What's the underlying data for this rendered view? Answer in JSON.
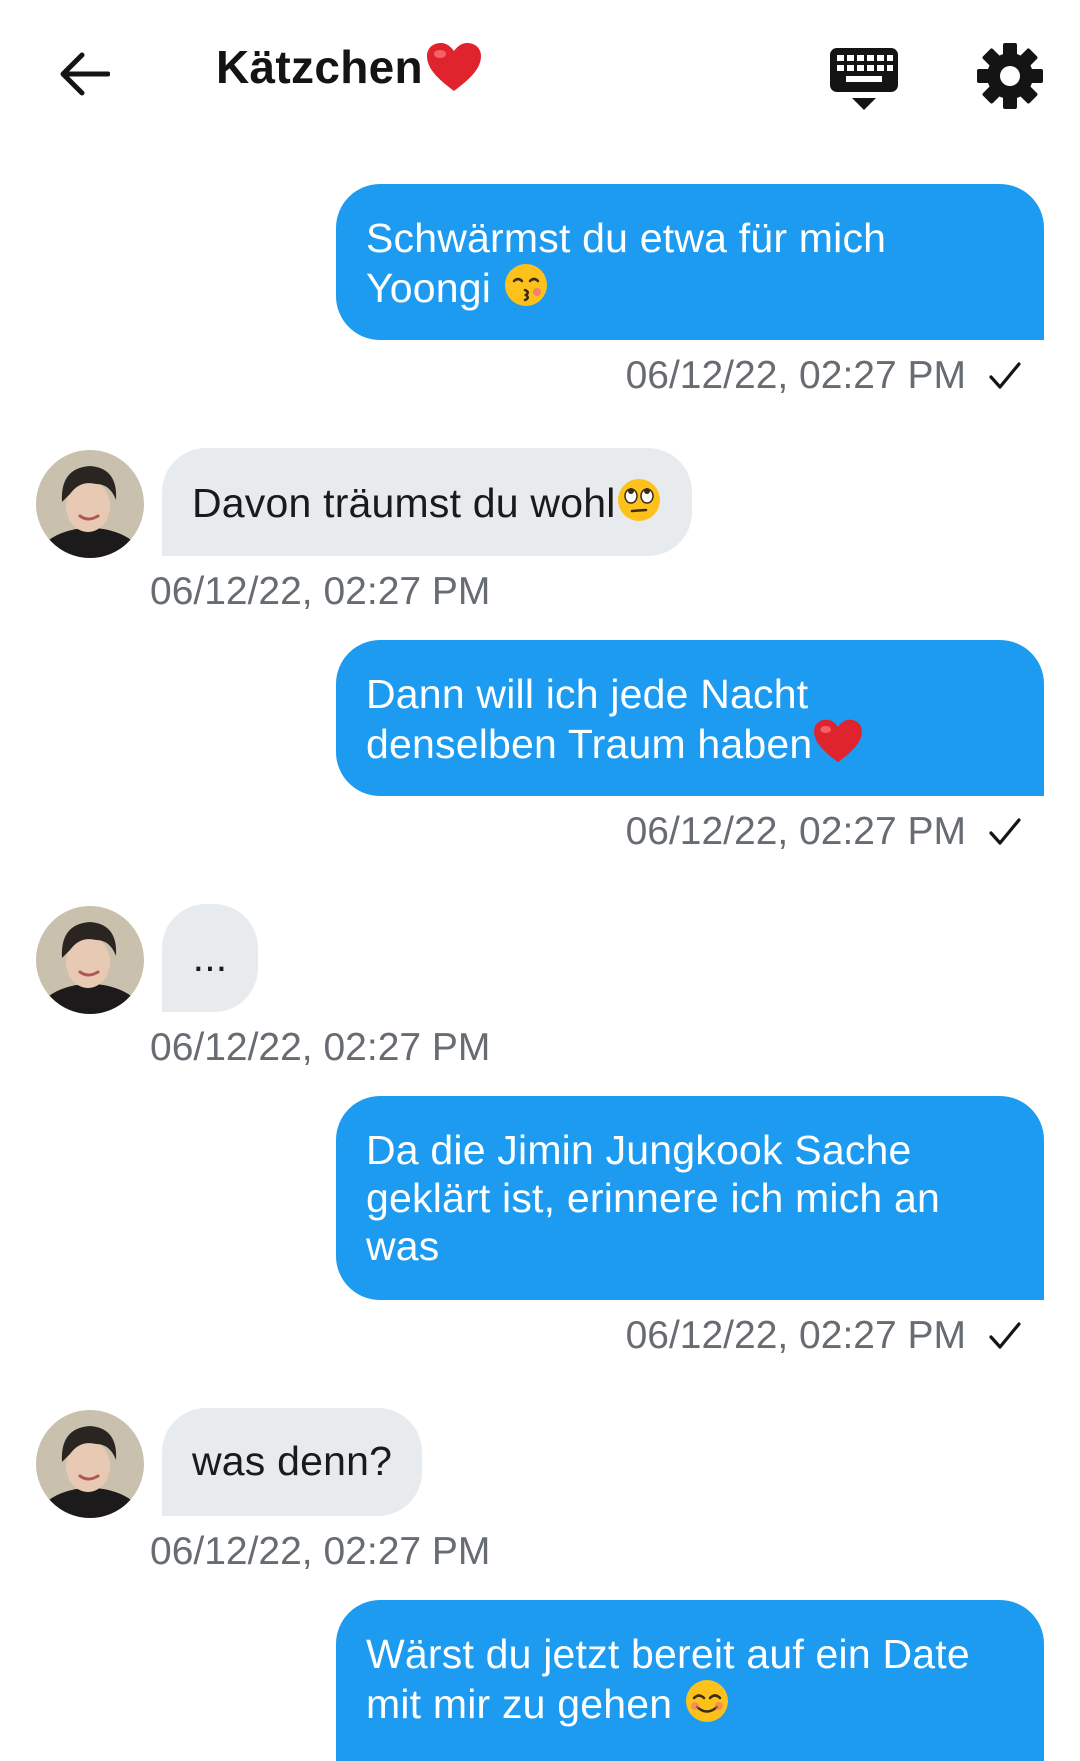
{
  "header": {
    "title": "Kätzchen",
    "title_emoji": "heart-emoji",
    "icons": [
      "back-arrow-icon",
      "keyboard-icon",
      "gear-icon"
    ]
  },
  "colors": {
    "outgoing_bubble": "#1d9bf0",
    "incoming_bubble": "#e8ebee",
    "timestamp": "#666c72"
  },
  "messages": [
    {
      "direction": "outgoing",
      "lines": [
        "Schwärmst du etwa für mich",
        "Yoongi "
      ],
      "emoji": "kissing-face-emoji",
      "time": "06/12/22, 02:27 PM",
      "sent_mark": "check"
    },
    {
      "direction": "incoming",
      "text": "Davon träumst du wohl",
      "emoji": "eye-roll-emoji",
      "time": "06/12/22, 02:27 PM"
    },
    {
      "direction": "outgoing",
      "lines": [
        "Dann will ich jede Nacht",
        "denselben Traum haben"
      ],
      "emoji": "heart-emoji",
      "time": "06/12/22, 02:27 PM",
      "sent_mark": "check"
    },
    {
      "direction": "incoming",
      "text": "...",
      "time": "06/12/22, 02:27 PM"
    },
    {
      "direction": "outgoing",
      "lines": [
        "Da die Jimin Jungkook Sache",
        "geklärt ist, erinnere ich mich an",
        "was"
      ],
      "time": "06/12/22, 02:27 PM",
      "sent_mark": "check"
    },
    {
      "direction": "incoming",
      "text": "was denn?",
      "time": "06/12/22, 02:27 PM"
    },
    {
      "direction": "outgoing",
      "lines": [
        "Wärst du jetzt bereit auf ein Date",
        "mit mir zu gehen "
      ],
      "emoji": "smiling-face-emoji"
    }
  ]
}
